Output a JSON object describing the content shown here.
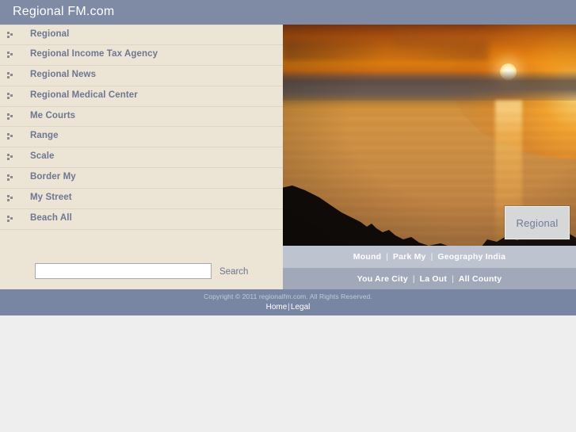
{
  "header": {
    "site_title": "Regional FM.com",
    "background_color": "#7f8aa5"
  },
  "sidebar": {
    "background_color": "#ece4d4",
    "bullet_icon": "three-dot-list-bullet-icon",
    "items": [
      {
        "label": "Regional"
      },
      {
        "label": "Regional Income Tax Agency"
      },
      {
        "label": "Regional News"
      },
      {
        "label": "Regional Medical Center"
      },
      {
        "label": "Me Courts"
      },
      {
        "label": "Range"
      },
      {
        "label": "Scale"
      },
      {
        "label": "Border My"
      },
      {
        "label": "My Street"
      },
      {
        "label": "Beach All"
      }
    ]
  },
  "search": {
    "value": "",
    "placeholder": "",
    "button_label": "Search"
  },
  "hero": {
    "alt": "sunset-over-sea-photo",
    "badge_label": "Regional"
  },
  "navbar_primary": {
    "background_color": "#bdc3cf",
    "separator": "|",
    "links": [
      "Mound",
      "Park My",
      "Geography India"
    ]
  },
  "navbar_secondary": {
    "background_color": "#a1a8ba",
    "separator": "|",
    "links": [
      "You Are City",
      "La Out",
      "All County"
    ]
  },
  "footer": {
    "background_color": "#7886a3",
    "copyright": "Copyright © 2011  regionalfm.com. All Rights Reserved.",
    "links": [
      "Home",
      "Legal"
    ],
    "separator": "|"
  }
}
